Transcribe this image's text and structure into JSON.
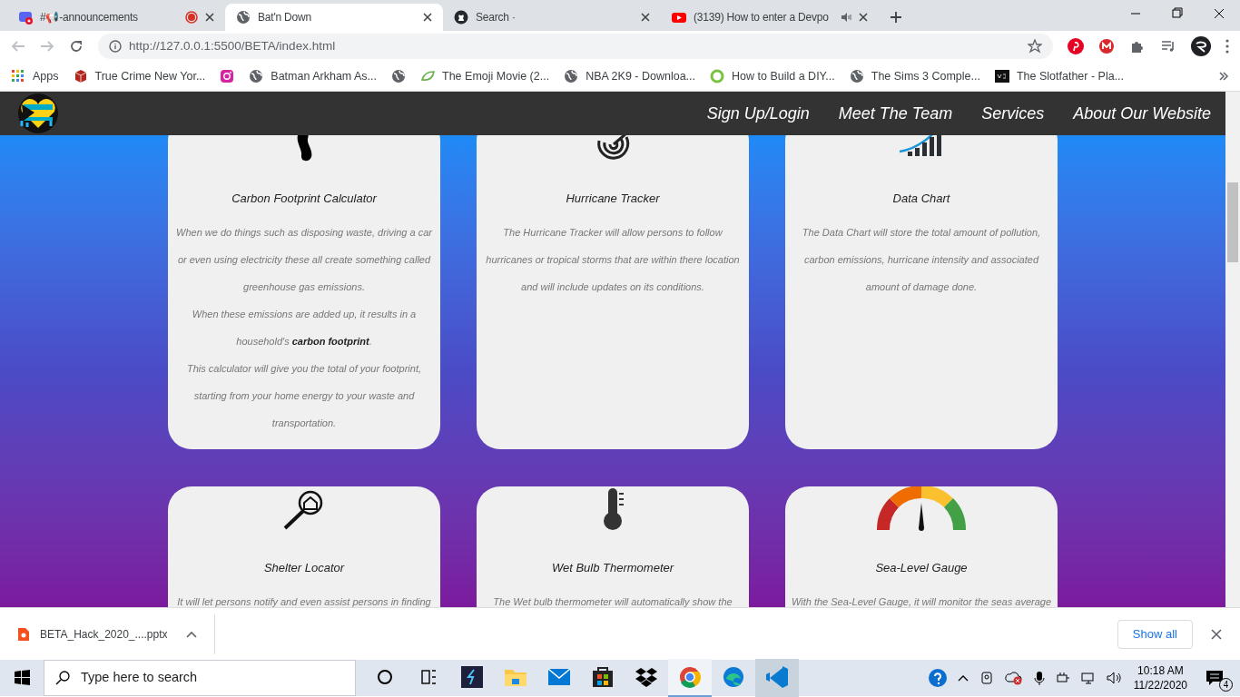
{
  "browser": {
    "tabs": [
      {
        "title": "#📢-announcements",
        "kind": "chat",
        "selected": false,
        "recording": true,
        "audio": false
      },
      {
        "title": "Bat'n Down",
        "kind": "globe",
        "selected": true,
        "recording": false,
        "audio": false
      },
      {
        "title": "Search ·",
        "kind": "octocat",
        "selected": false,
        "recording": false,
        "audio": false
      },
      {
        "title": "(3139) How to enter a Devpo",
        "kind": "video",
        "selected": false,
        "recording": false,
        "audio": true
      }
    ],
    "address": "http://127.0.0.1:5500/BETA/index.html",
    "bookmarks": [
      {
        "label": "Apps",
        "kind": "grid"
      },
      {
        "label": "True Crime New Yor...",
        "kind": "cube"
      },
      {
        "kind": "camera"
      },
      {
        "label": "Batman Arkham As...",
        "kind": "globe"
      },
      {
        "kind": "globe"
      },
      {
        "label": "The Emoji Movie (2...",
        "kind": "leaf"
      },
      {
        "label": "NBA 2K9 - Downloa...",
        "kind": "globe"
      },
      {
        "label": "How to Build a DIY...",
        "kind": "ring"
      },
      {
        "label": "The Sims 3 Comple...",
        "kind": "globe"
      },
      {
        "label": "The Slotfather - Pla...",
        "kind": "square"
      }
    ]
  },
  "site": {
    "nav": [
      "Sign Up/Login",
      "Meet The Team",
      "Services",
      "About Our Website"
    ],
    "cards": [
      {
        "kind": "footprint",
        "title": "Carbon Footprint Calculator",
        "paragraphs": [
          "When we do things such as disposing waste, driving a car or even using electricity these all create something called greenhouse gas emissions.",
          "When these emissions are added up, it results in a household's **carbon footprint**.",
          "This calculator will give you the total of your footprint, starting from your home energy to your waste and transportation."
        ]
      },
      {
        "kind": "radar",
        "title": "Hurricane Tracker",
        "paragraphs": [
          "The Hurricane Tracker will allow persons to follow hurricanes or tropical storms that are within there location and will include updates on its conditions."
        ]
      },
      {
        "kind": "bars",
        "title": "Data Chart",
        "paragraphs": [
          "The Data Chart will store the total amount of pollution, carbon emissions, hurricane intensity and associated amount of damage done."
        ]
      },
      {
        "kind": "house-search",
        "title": "Shelter Locator",
        "paragraphs": [
          "It will let persons notify and even assist persons in finding"
        ]
      },
      {
        "kind": "thermometer",
        "title": "Wet Bulb Thermometer",
        "paragraphs": [
          "The Wet bulb thermometer will automatically show the"
        ]
      },
      {
        "kind": "gauge",
        "title": "Sea-Level Gauge",
        "paragraphs": [
          "With the Sea-Level Gauge, it will monitor the seas average"
        ]
      }
    ]
  },
  "download_bar": {
    "file": "BETA_Hack_2020_....pptx",
    "button": "Show all"
  },
  "taskbar": {
    "search_placeholder": "Type here to search",
    "time": "10:18 AM",
    "date": "11/22/2020",
    "notifications": "4"
  }
}
